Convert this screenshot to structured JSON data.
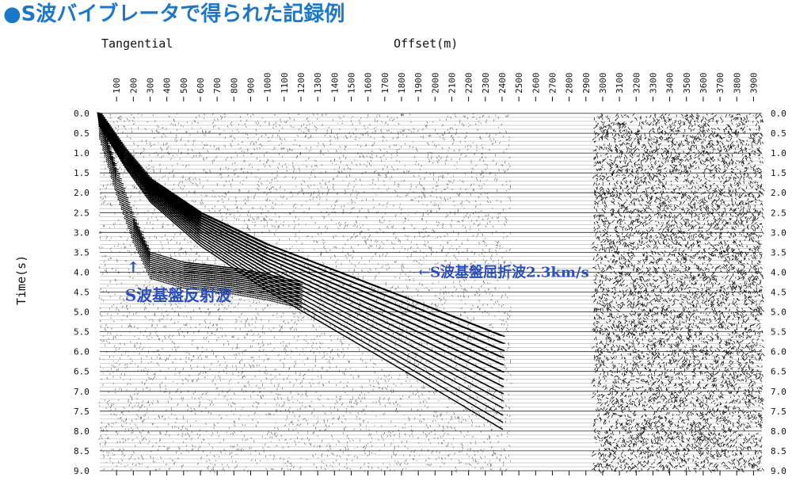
{
  "title": "●S波バイブレータで得られた記録例",
  "record_component": "Tangential",
  "colors": {
    "title": "#1d77c8",
    "annotation": "#2a4fbf",
    "trace": "#000000"
  },
  "chart_data": {
    "type": "seismic-record",
    "xlabel": "Offset(m)",
    "ylabel": "Time(s)",
    "xlim": [
      0,
      3950
    ],
    "ylim": [
      9.0,
      0.0
    ],
    "x_ticks": [
      100,
      200,
      300,
      400,
      500,
      600,
      700,
      800,
      900,
      1000,
      1100,
      1200,
      1300,
      1400,
      1500,
      1600,
      1700,
      1800,
      1900,
      2000,
      2100,
      2200,
      2300,
      2400,
      2500,
      2600,
      2700,
      2800,
      2900,
      3000,
      3100,
      3200,
      3300,
      3400,
      3500,
      3600,
      3700,
      3800,
      3900
    ],
    "y_ticks": [
      "0.0",
      "0.5",
      "1.0",
      "1.5",
      "2.0",
      "2.5",
      "3.0",
      "3.5",
      "4.0",
      "4.5",
      "5.0",
      "5.5",
      "6.0",
      "6.5",
      "7.0",
      "7.5",
      "8.0",
      "8.5",
      "9.0"
    ],
    "grid": true,
    "data_gap_offsets": [
      2450,
      2950
    ],
    "events": [
      {
        "name": "S波基盤屈折波2.3km/s",
        "type": "refraction",
        "offsets": [
          0,
          150,
          300,
          600,
          1000,
          1400,
          1800,
          2100,
          2400
        ],
        "times": [
          0.0,
          0.9,
          1.65,
          2.5,
          3.3,
          3.95,
          4.6,
          5.1,
          5.6
        ]
      },
      {
        "name": "S波基盤反射波",
        "type": "reflection",
        "offsets": [
          0,
          100,
          200,
          300,
          500,
          800,
          1000,
          1200
        ],
        "times": [
          0.0,
          1.4,
          2.6,
          3.5,
          3.75,
          3.9,
          4.05,
          4.25
        ]
      }
    ],
    "annotations": [
      {
        "text": "←S波基盤屈折波2.3km/s",
        "offset": 1900,
        "time": 4.0
      },
      {
        "text": "↑",
        "offset": 160,
        "time": 3.9
      },
      {
        "text": "S波基盤反射波",
        "offset": 150,
        "time": 4.6
      }
    ]
  }
}
